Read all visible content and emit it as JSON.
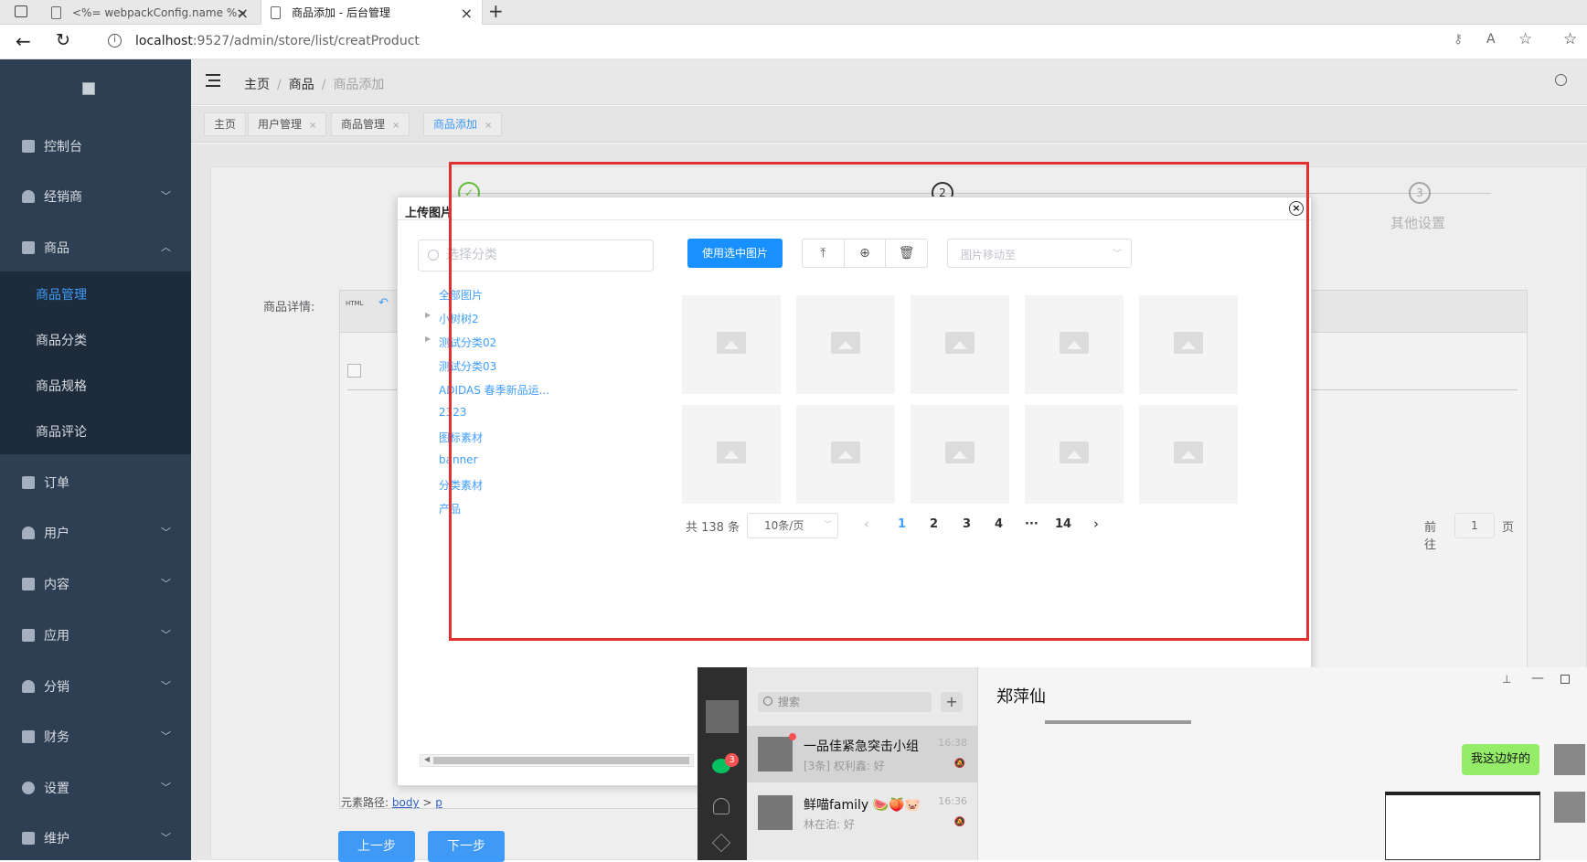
{
  "browser": {
    "tabs": [
      {
        "title": "<%= webpackConfig.name %>"
      },
      {
        "title": "商品添加 - 后台管理"
      }
    ],
    "url_host": "localhost",
    "url_path": ":9527/admin/store/list/creatProduct"
  },
  "sidebar": {
    "items": [
      {
        "label": "控制台",
        "icon": "dashboard-icon"
      },
      {
        "label": "经销商",
        "icon": "user-icon"
      },
      {
        "label": "商品",
        "icon": "shopping-bag-icon"
      },
      {
        "label": "订单",
        "icon": "order-icon"
      },
      {
        "label": "用户",
        "icon": "user-icon"
      },
      {
        "label": "内容",
        "icon": "content-icon"
      },
      {
        "label": "应用",
        "icon": "send-icon"
      },
      {
        "label": "分销",
        "icon": "user-icon"
      },
      {
        "label": "财务",
        "icon": "finance-icon"
      },
      {
        "label": "设置",
        "icon": "gear-icon"
      },
      {
        "label": "维护",
        "icon": "tool-icon"
      }
    ],
    "sub_items": [
      "商品管理",
      "商品分类",
      "商品规格",
      "商品评论"
    ]
  },
  "breadcrumb": [
    "主页",
    "商品",
    "商品添加"
  ],
  "tags": [
    "主页",
    "用户管理",
    "商品管理",
    "商品添加"
  ],
  "page": {
    "steps": [
      "2",
      "3",
      "其他设置"
    ],
    "detail_label": "商品详情:",
    "editor_path_label": "元素路径:",
    "editor_path_body": "body",
    "editor_path_p": "p",
    "prev_button": "上一步",
    "next_button": "下一步"
  },
  "dialog": {
    "title": "上传图片",
    "category_placeholder": "选择分类",
    "categories": [
      {
        "label": "全部图片"
      },
      {
        "label": "小树树2",
        "expandable": true
      },
      {
        "label": "测试分类02",
        "expandable": true
      },
      {
        "label": "测试分类03"
      },
      {
        "label": "ADIDAS 春季新品运..."
      },
      {
        "label": "2323"
      },
      {
        "label": "图标素材"
      },
      {
        "label": "banner"
      },
      {
        "label": "分类素材"
      },
      {
        "label": "产品"
      }
    ],
    "use_selected_button": "使用选中图片",
    "move_placeholder": "图片移动至",
    "pagination": {
      "total_text": "共 138 条",
      "page_size": "10条/页",
      "pages": [
        "1",
        "2",
        "3",
        "4",
        "···",
        "14"
      ],
      "current": "1",
      "goto_label": "前往",
      "goto_value": "1",
      "page_suffix": "页"
    }
  },
  "wechat": {
    "search_placeholder": "搜索",
    "badge_count": "3",
    "chats": [
      {
        "name": "一品佳紧急突击小组",
        "message": "[3条] 权利鑫: 好",
        "time": "16:38"
      },
      {
        "name": "鲜喵family 🍉🍑🐷",
        "message": "林在泊: 好",
        "time": "16:36"
      }
    ],
    "active_title": "郑萍仙",
    "bubble_text": "我这边好的"
  },
  "colors": {
    "sidebar_bg": "#304156",
    "accent": "#409eff",
    "primary_button": "#1890ff",
    "highlight_frame": "#e23030"
  }
}
